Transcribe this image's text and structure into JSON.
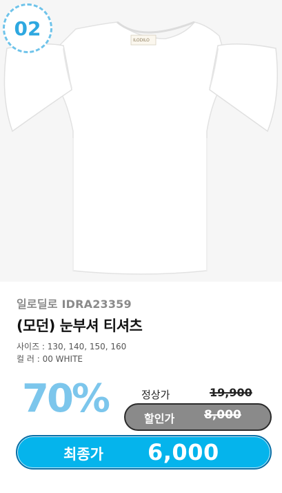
{
  "badge": {
    "number": "02"
  },
  "product": {
    "image_label": "ILODILO",
    "brand_line": "일로딜로 IDRA23359",
    "title": "(모던) 눈부셔 티셔츠",
    "size_text": "사이즈 : 130, 140, 150, 160",
    "color_text": "컬    러 : 00 WHITE"
  },
  "pricing": {
    "discount": "70%",
    "regular_label": "정상가",
    "regular_price": "19,900",
    "sale_label": "할인가",
    "sale_price": "8,000",
    "final_label": "최종가",
    "final_price": "6,000"
  }
}
